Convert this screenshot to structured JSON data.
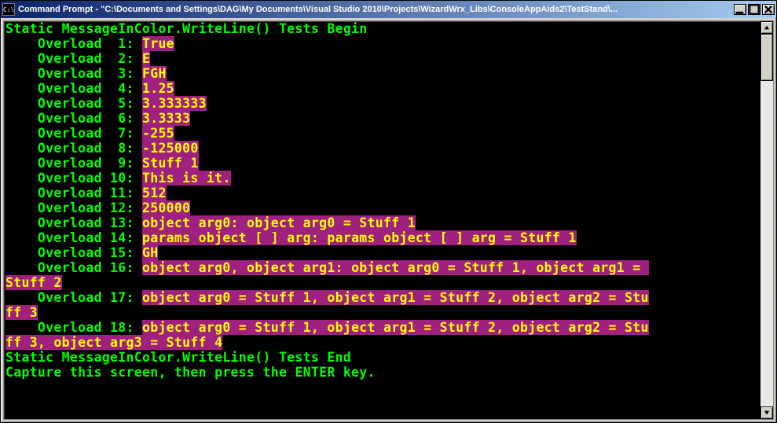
{
  "window": {
    "title": "Command Prompt - \"C:\\Documents and Settings\\DAG\\My Documents\\Visual Studio 2010\\Projects\\WizardWrx_Libs\\ConsoleAppAids2\\TestStand\\...",
    "icon_label": "C:\\"
  },
  "buttons": {
    "minimize": "_",
    "maximize": "□",
    "close": "×"
  },
  "header": "Static MessageInColor.WriteLine() Tests Begin",
  "overloads": [
    {
      "n": " 1",
      "val": "True"
    },
    {
      "n": " 2",
      "val": "E"
    },
    {
      "n": " 3",
      "val": "FGH"
    },
    {
      "n": " 4",
      "val": "1.25"
    },
    {
      "n": " 5",
      "val": "3.333333"
    },
    {
      "n": " 6",
      "val": "3.3333"
    },
    {
      "n": " 7",
      "val": "-255"
    },
    {
      "n": " 8",
      "val": "-125000"
    },
    {
      "n": " 9",
      "val": "Stuff 1"
    },
    {
      "n": "10",
      "val": "This is it."
    },
    {
      "n": "11",
      "val": "512"
    },
    {
      "n": "12",
      "val": "250000"
    },
    {
      "n": "13",
      "val": "object arg0: object arg0 = Stuff 1"
    },
    {
      "n": "14",
      "val": "params object [ ] arg: params object [ ] arg = Stuff 1"
    },
    {
      "n": "15",
      "val": "GH"
    }
  ],
  "wrap16": {
    "label": "    Overload 16: ",
    "part1": "object arg0, object arg1: object arg0 = Stuff 1, object arg1 = ",
    "part2": "Stuff 2"
  },
  "wrap17": {
    "label": "    Overload 17: ",
    "part1": "object arg0 = Stuff 1, object arg1 = Stuff 2, object arg2 = Stu",
    "part2": "ff 3"
  },
  "wrap18": {
    "label": "    Overload 18: ",
    "part1": "object arg0 = Stuff 1, object arg1 = Stuff 2, object arg2 = Stu",
    "part2": "ff 3, object arg3 = Stuff 4"
  },
  "footer1": "Static MessageInColor.WriteLine() Tests End",
  "footer2": "Capture this screen, then press the ENTER key."
}
